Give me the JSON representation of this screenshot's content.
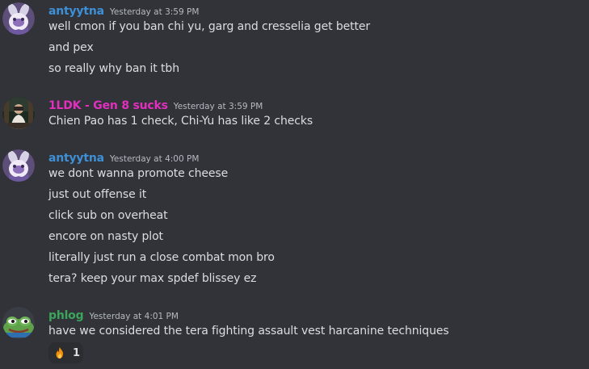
{
  "colors": {
    "background": "#313338",
    "text": "#dbdee1",
    "timestamp": "#b5bac1",
    "user_blue": "#3e90d6",
    "user_pink": "#e22fbe",
    "user_green": "#3ba55c"
  },
  "messages": [
    {
      "author": "antyytna",
      "timestamp": "Yesterday at 3:59 PM",
      "avatar_icon": "pokemon-avatar-purple",
      "lines": [
        "well cmon if you ban chi yu, garg and cresselia get better",
        "and pex",
        "so really why ban it tbh"
      ]
    },
    {
      "author": "1LDK - Gen 8 sucks",
      "timestamp": "Yesterday at 3:59 PM",
      "avatar_icon": "photo-avatar",
      "lines": [
        "Chien Pao has 1 check, Chi-Yu has like 2 checks"
      ]
    },
    {
      "author": "antyytna",
      "timestamp": "Yesterday at 4:00 PM",
      "avatar_icon": "pokemon-avatar-purple",
      "lines": [
        "we dont wanna promote cheese",
        "just out offense it",
        "click sub on overheat",
        "encore on nasty plot",
        "literally just run a close combat mon bro",
        "tera? keep your max spdef blissey ez"
      ]
    },
    {
      "author": "phlog",
      "timestamp": "Yesterday at 4:01 PM",
      "avatar_icon": "frog-avatar",
      "lines": [
        "have we considered the tera fighting assault vest harcanine techniques"
      ],
      "reaction": {
        "emoji_icon": "fire-emoji",
        "count": "1"
      }
    }
  ]
}
